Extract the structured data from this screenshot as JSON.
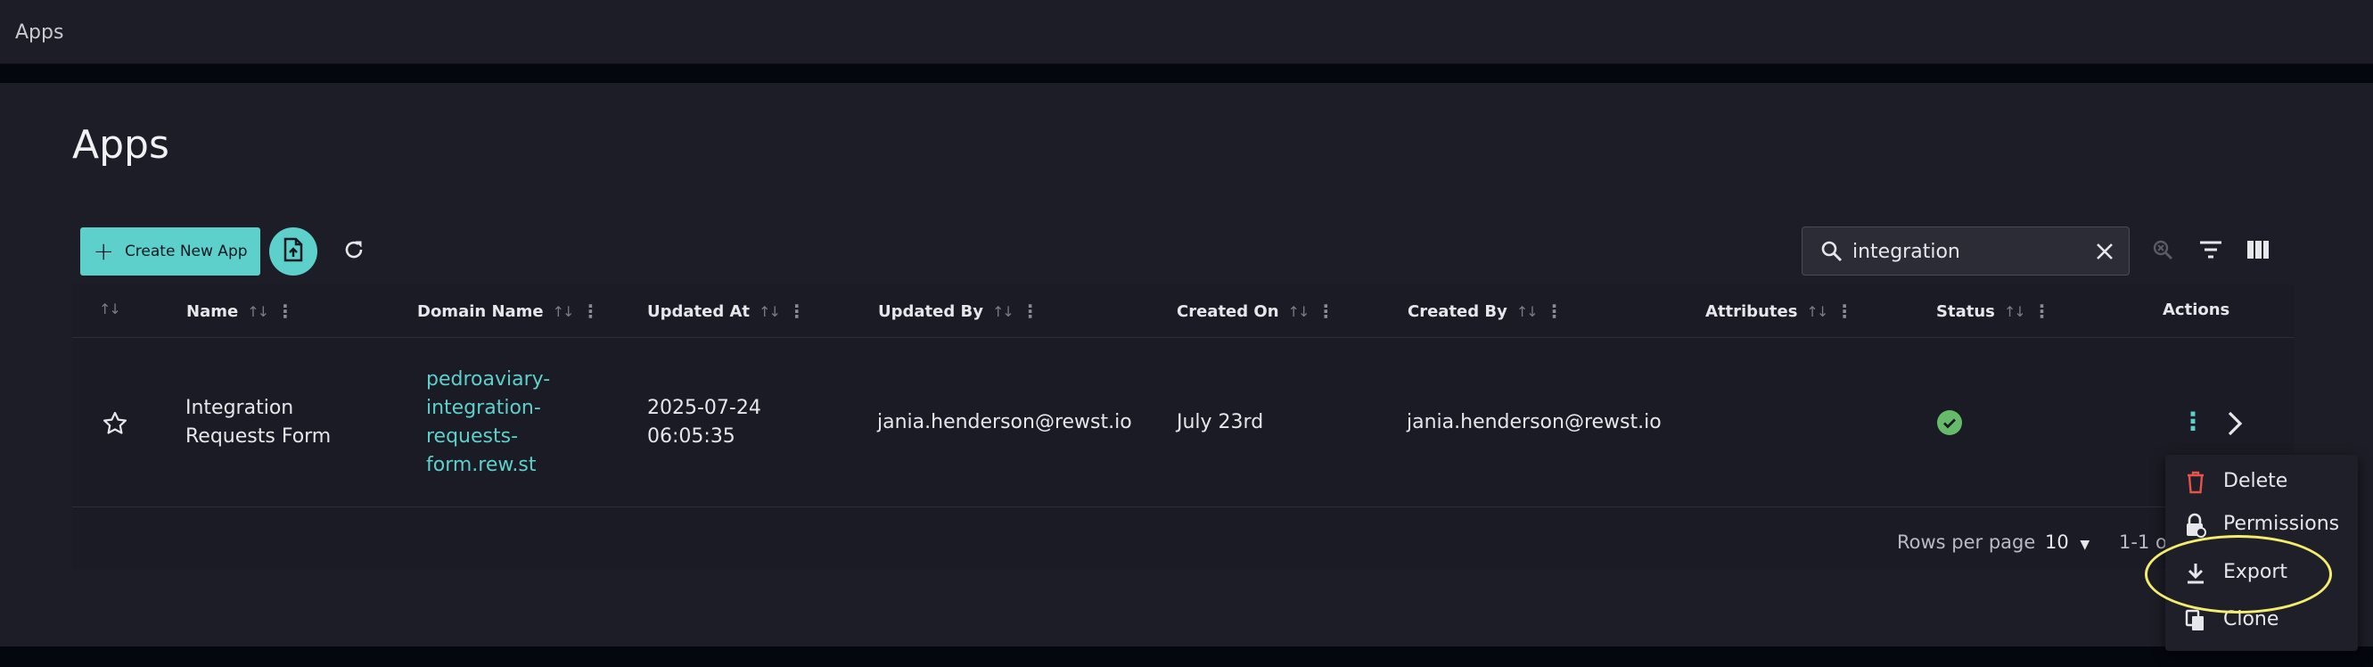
{
  "topbar": {
    "title": "Apps"
  },
  "page": {
    "title": "Apps"
  },
  "toolbar": {
    "create_label": "Create New App",
    "search_value": "integration"
  },
  "table": {
    "columns": [
      {
        "key": "name",
        "label": "Name"
      },
      {
        "key": "domain",
        "label": "Domain Name"
      },
      {
        "key": "updated_at",
        "label": "Updated At"
      },
      {
        "key": "updated_by",
        "label": "Updated By"
      },
      {
        "key": "created_on",
        "label": "Created On"
      },
      {
        "key": "created_by",
        "label": "Created By"
      },
      {
        "key": "attributes",
        "label": "Attributes"
      },
      {
        "key": "status",
        "label": "Status"
      },
      {
        "key": "actions",
        "label": "Actions"
      }
    ],
    "rows": [
      {
        "name_line1": "Integration",
        "name_line2": "Requests Form",
        "domain_line1": "pedroaviary-",
        "domain_line2": "integration-",
        "domain_line3": "requests-",
        "domain_line4": "form.rew.st",
        "updated_at_line1": "2025-07-24",
        "updated_at_line2": "06:05:35",
        "updated_by": "jania.henderson@rewst.io",
        "created_on": "July 23rd",
        "created_by": "jania.henderson@rewst.io",
        "status": "active"
      }
    ]
  },
  "footer": {
    "rows_per_page_label": "Rows per page",
    "rows_per_page_value": "10",
    "range_text": "1-1 of"
  },
  "menu": {
    "items": [
      {
        "label": "Delete",
        "icon": "trash-icon",
        "color": "#e5534b"
      },
      {
        "label": "Permissions",
        "icon": "lock-icon"
      },
      {
        "label": "Export",
        "icon": "download-icon"
      },
      {
        "label": "Clone",
        "icon": "copy-icon"
      }
    ]
  },
  "colors": {
    "accent": "#5dd0cc",
    "background": "#1c1d26",
    "status_ok": "#66bb6a",
    "highlight": "#f4ec6e",
    "delete": "#e5534b"
  }
}
